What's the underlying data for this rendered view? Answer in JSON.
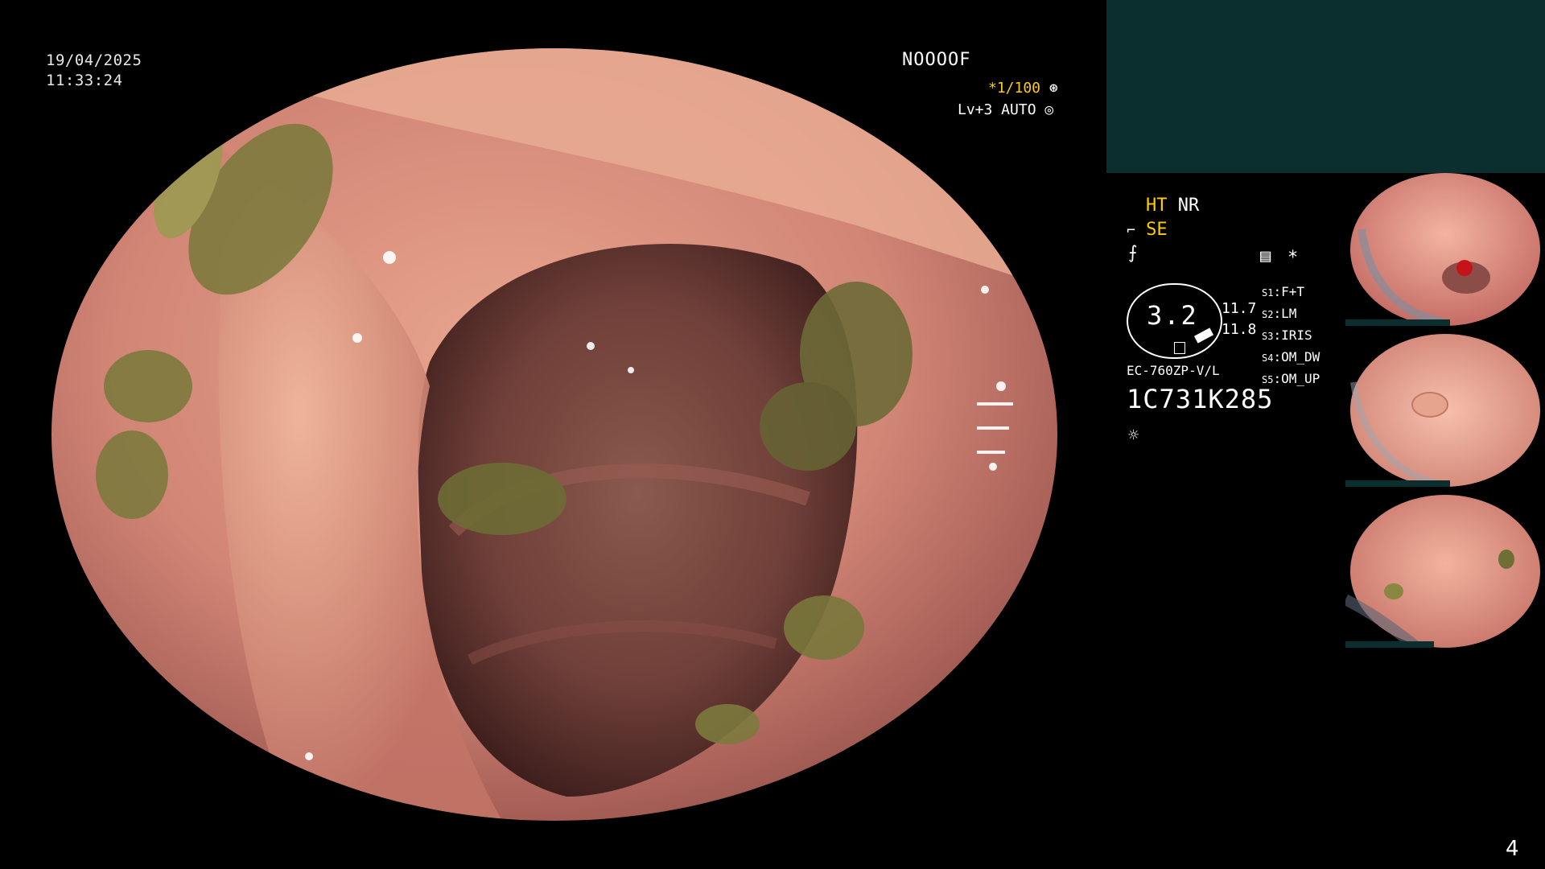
{
  "overlay": {
    "date": "19/04/2025",
    "time": "11:33:24",
    "patient_id": "NOOOOF",
    "shutter": "*1/100",
    "level": "Lv+3 AUTO",
    "page_number": "4"
  },
  "hud": {
    "ht_label": "HT",
    "nr_label": "NR",
    "se_label": "SE",
    "asterisk": "*",
    "gauge_value": "3.2",
    "value_top": "11.7",
    "value_bottom": "11.8",
    "scope_model": "EC-760ZP-V/L",
    "serial": "1C731K285",
    "settings": [
      {
        "key": "S1",
        "value": "F+T"
      },
      {
        "key": "S2",
        "value": "LM"
      },
      {
        "key": "S3",
        "value": "IRIS"
      },
      {
        "key": "S4",
        "value": "OM_DW"
      },
      {
        "key": "S5",
        "value": "OM_UP"
      }
    ]
  },
  "colors": {
    "accent_yellow": "#ffcc00",
    "panel_teal": "#0b2f2e",
    "mucosa": "#c9736a"
  },
  "icons": [
    "shutter-icon",
    "auto-iris-icon",
    "scope-icon",
    "freeze-icon",
    "memo-icon",
    "light-icon"
  ]
}
